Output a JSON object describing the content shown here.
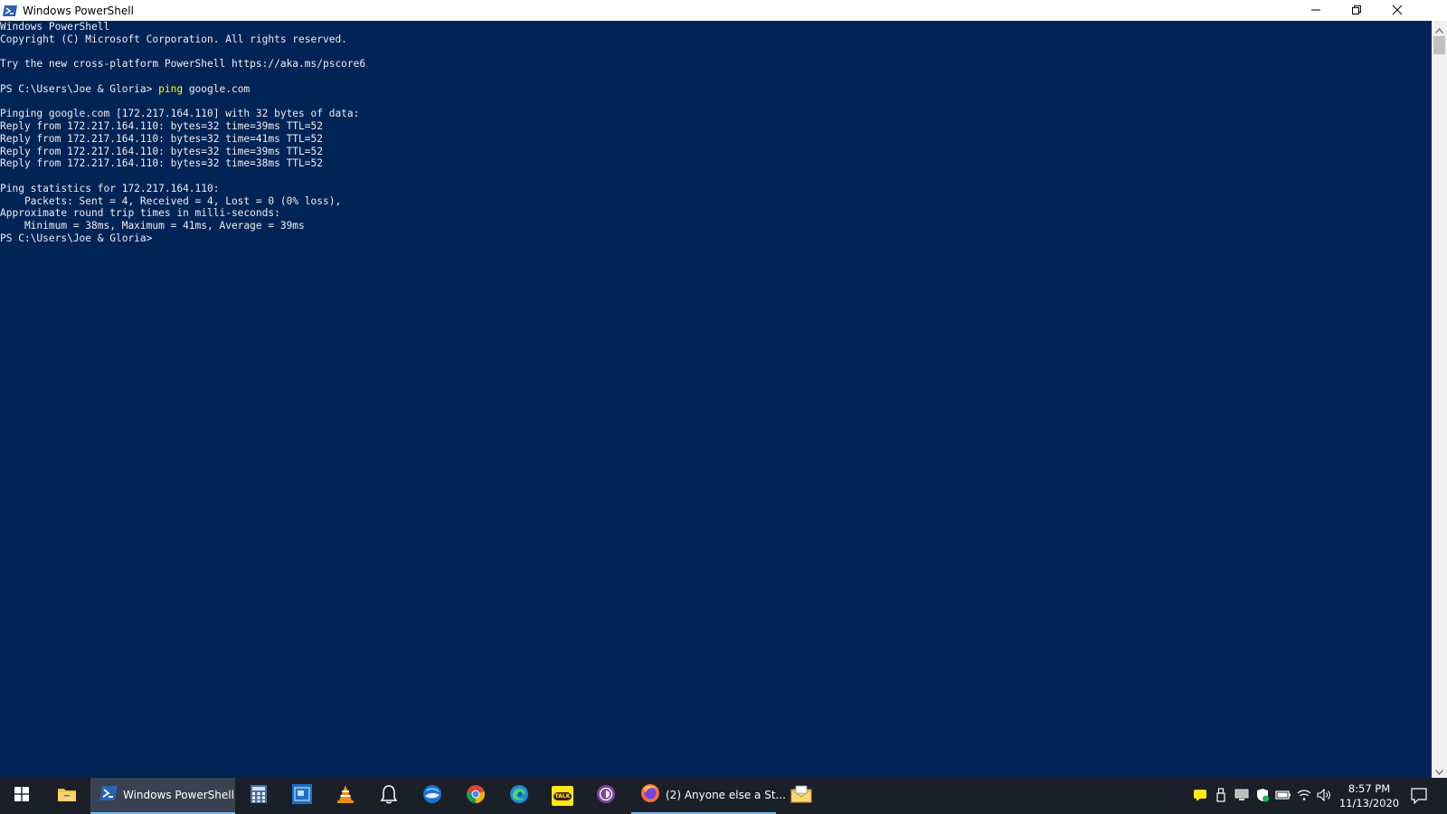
{
  "window": {
    "title": "Windows PowerShell",
    "controls": {
      "minimize": "minimize-icon",
      "restore": "restore-icon",
      "close": "close-icon"
    }
  },
  "console": {
    "lines_before_command": [
      "Windows PowerShell",
      "Copyright (C) Microsoft Corporation. All rights reserved.",
      "",
      "Try the new cross-platform PowerShell https://aka.ms/pscore6",
      ""
    ],
    "prompt": "PS C:\\Users\\Joe & Gloria> ",
    "command_keyword": "ping",
    "command_args": " google.com",
    "lines_after_command": [
      "",
      "Pinging google.com [172.217.164.110] with 32 bytes of data:",
      "Reply from 172.217.164.110: bytes=32 time=39ms TTL=52",
      "Reply from 172.217.164.110: bytes=32 time=41ms TTL=52",
      "Reply from 172.217.164.110: bytes=32 time=39ms TTL=52",
      "Reply from 172.217.164.110: bytes=32 time=38ms TTL=52",
      "",
      "Ping statistics for 172.217.164.110:",
      "    Packets: Sent = 4, Received = 4, Lost = 0 (0% loss),",
      "Approximate round trip times in milli-seconds:",
      "    Minimum = 38ms, Maximum = 41ms, Average = 39ms"
    ],
    "final_prompt": "PS C:\\Users\\Joe & Gloria>",
    "colors": {
      "background": "#012456",
      "foreground": "#eeedf0",
      "command_keyword": "#ffff00"
    }
  },
  "taskbar": {
    "start_icon": "windows-start-icon",
    "apps": [
      {
        "name": "file-explorer",
        "icon": "folder-icon"
      },
      {
        "name": "windows-powershell",
        "icon": "powershell-icon",
        "label": "Windows PowerShell",
        "active": true
      },
      {
        "name": "calculator",
        "icon": "calculator-icon"
      },
      {
        "name": "app-blue-window",
        "icon": "blue-window-icon"
      },
      {
        "name": "vlc",
        "icon": "vlc-cone-icon"
      },
      {
        "name": "notifications-app",
        "icon": "bell-icon"
      },
      {
        "name": "thunderbird",
        "icon": "thunderbird-icon"
      },
      {
        "name": "chrome",
        "icon": "chrome-icon"
      },
      {
        "name": "edge",
        "icon": "edge-icon"
      },
      {
        "name": "kakaotalk",
        "icon": "kakaotalk-icon",
        "badge": "TALK"
      },
      {
        "name": "tor-browser",
        "icon": "tor-icon"
      },
      {
        "name": "firefox",
        "icon": "firefox-icon",
        "label": "(2) Anyone else a St..."
      },
      {
        "name": "mail-app",
        "icon": "envelope-icon"
      }
    ],
    "tray": {
      "icons": [
        "chat-icon",
        "usb-eject-icon",
        "monitor-icon",
        "shield-icon",
        "battery-icon",
        "wifi-icon",
        "volume-icon"
      ],
      "time": "8:57 PM",
      "date": "11/13/2020",
      "action_center_icon": "action-center-icon"
    },
    "accent_color": "#76b9ed"
  }
}
